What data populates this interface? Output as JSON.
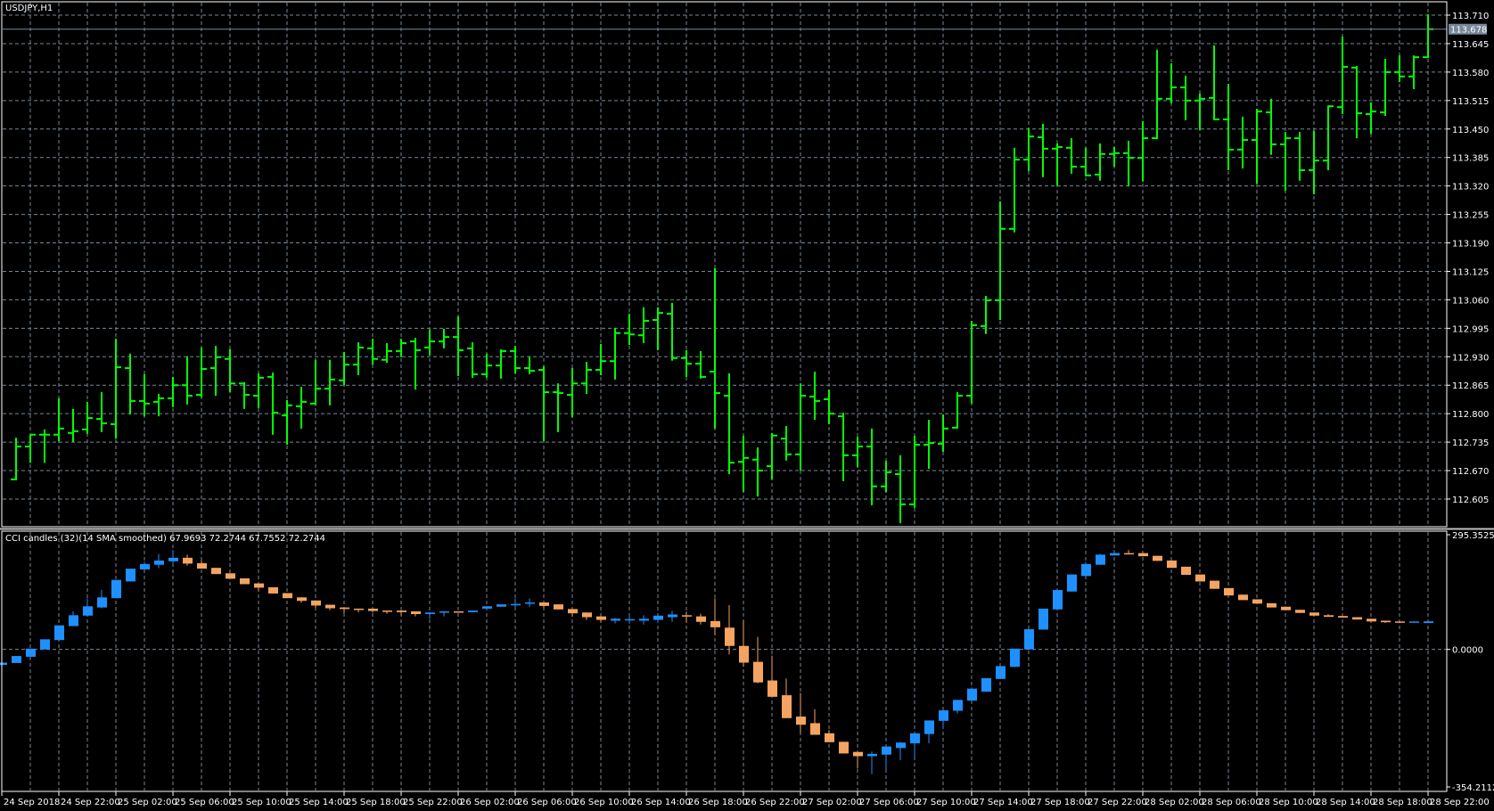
{
  "window": {
    "symbol_title": "USDJPY,H1"
  },
  "colors": {
    "background": "#000000",
    "grid": "#778899",
    "bars": "#00ff00",
    "cci_up": "#1e90ff",
    "cci_down": "#f4a460",
    "axis": "#ffffff",
    "current_price_bg": "#778899"
  },
  "chart_data": [
    {
      "type": "ohlc",
      "title": "USDJPY,H1",
      "ylim": [
        112.605,
        113.71
      ],
      "price_ticks": [
        "113.710",
        "113.645",
        "113.580",
        "113.515",
        "113.450",
        "113.385",
        "113.320",
        "113.255",
        "113.190",
        "113.125",
        "113.060",
        "112.995",
        "112.930",
        "112.865",
        "112.800",
        "112.735",
        "112.670",
        "112.605"
      ],
      "current_price": "113.678",
      "grid": true,
      "first_bar": 1,
      "bars_ohlc": [
        [
          112.65,
          112.745,
          112.65,
          112.725
        ],
        [
          112.725,
          112.752,
          112.69,
          112.752
        ],
        [
          112.752,
          112.764,
          112.69,
          112.752
        ],
        [
          112.752,
          112.835,
          112.739,
          112.766
        ],
        [
          112.756,
          112.811,
          112.737,
          112.76
        ],
        [
          112.764,
          112.827,
          112.756,
          112.79
        ],
        [
          112.788,
          112.849,
          112.76,
          112.778
        ],
        [
          112.776,
          112.971,
          112.745,
          112.906
        ],
        [
          112.904,
          112.937,
          112.8,
          112.829
        ],
        [
          112.829,
          112.89,
          112.796,
          112.823
        ],
        [
          112.827,
          112.845,
          112.796,
          112.835
        ],
        [
          112.835,
          112.884,
          112.817,
          112.865
        ],
        [
          112.865,
          112.931,
          112.823,
          112.841
        ],
        [
          112.843,
          112.951,
          112.839,
          112.902
        ],
        [
          112.904,
          112.955,
          112.843,
          112.929
        ],
        [
          112.925,
          112.947,
          112.851,
          112.869
        ],
        [
          112.869,
          112.872,
          112.813,
          112.843
        ],
        [
          112.841,
          112.892,
          112.815,
          112.882
        ],
        [
          112.884,
          112.894,
          112.754,
          112.802
        ],
        [
          112.796,
          112.831,
          112.731,
          112.819
        ],
        [
          112.817,
          112.861,
          112.768,
          112.827
        ],
        [
          112.823,
          112.923,
          112.821,
          112.857
        ],
        [
          112.857,
          112.923,
          112.821,
          112.878
        ],
        [
          112.876,
          112.941,
          112.867,
          112.912
        ],
        [
          112.912,
          112.963,
          112.89,
          112.951
        ],
        [
          112.949,
          112.971,
          112.914,
          112.925
        ],
        [
          112.923,
          112.961,
          112.918,
          112.943
        ],
        [
          112.943,
          112.971,
          112.931,
          112.961
        ],
        [
          112.965,
          112.973,
          112.857,
          112.945
        ],
        [
          112.951,
          112.992,
          112.935,
          112.965
        ],
        [
          112.965,
          112.994,
          112.951,
          112.975
        ],
        [
          112.975,
          113.022,
          112.888,
          112.945
        ],
        [
          112.949,
          112.963,
          112.884,
          112.89
        ],
        [
          112.89,
          112.937,
          112.884,
          112.91
        ],
        [
          112.91,
          112.947,
          112.882,
          112.943
        ],
        [
          112.943,
          112.955,
          112.894,
          112.904
        ],
        [
          112.904,
          112.931,
          112.892,
          112.898
        ],
        [
          112.9,
          112.908,
          112.739,
          112.849
        ],
        [
          112.849,
          112.869,
          112.76,
          112.847
        ],
        [
          112.843,
          112.904,
          112.794,
          112.869
        ],
        [
          112.869,
          112.918,
          112.847,
          112.9
        ],
        [
          112.9,
          112.959,
          112.89,
          112.92
        ],
        [
          112.92,
          112.996,
          112.88,
          112.984
        ],
        [
          112.984,
          113.028,
          112.959,
          112.981
        ],
        [
          112.979,
          113.043,
          112.963,
          113.012
        ],
        [
          113.014,
          113.043,
          112.947,
          113.03
        ],
        [
          113.028,
          113.053,
          112.923,
          112.927
        ],
        [
          112.927,
          112.945,
          112.886,
          112.914
        ],
        [
          112.914,
          112.943,
          112.882,
          112.884
        ],
        [
          112.896,
          113.132,
          112.768,
          112.847
        ],
        [
          112.841,
          112.892,
          112.664,
          112.688
        ],
        [
          112.69,
          112.75,
          112.623,
          112.699
        ],
        [
          112.695,
          112.723,
          112.613,
          112.67
        ],
        [
          112.68,
          112.756,
          112.652,
          112.75
        ],
        [
          112.743,
          112.772,
          112.695,
          112.707
        ],
        [
          112.707,
          112.869,
          112.672,
          112.841
        ],
        [
          112.839,
          112.896,
          112.788,
          112.829
        ],
        [
          112.833,
          112.855,
          112.778,
          112.8
        ],
        [
          112.794,
          112.802,
          112.648,
          112.705
        ],
        [
          112.705,
          112.747,
          112.68,
          112.725
        ],
        [
          112.725,
          112.766,
          112.593,
          112.634
        ],
        [
          112.634,
          112.692,
          112.623,
          112.666
        ],
        [
          112.662,
          112.705,
          112.552,
          112.593
        ],
        [
          112.593,
          112.75,
          112.587,
          112.729
        ],
        [
          112.729,
          112.786,
          112.676,
          112.733
        ],
        [
          112.731,
          112.798,
          112.715,
          112.766
        ],
        [
          112.768,
          112.849,
          112.768,
          112.841
        ],
        [
          112.841,
          113.012,
          112.825,
          113.002
        ],
        [
          113.0,
          113.069,
          112.984,
          113.059
        ],
        [
          113.059,
          113.285,
          113.016,
          113.222
        ],
        [
          113.222,
          113.407,
          113.216,
          113.38
        ],
        [
          113.38,
          113.452,
          113.356,
          113.433
        ],
        [
          113.431,
          113.462,
          113.342,
          113.405
        ],
        [
          113.405,
          113.417,
          113.323,
          113.409
        ],
        [
          113.407,
          113.429,
          113.35,
          113.364
        ],
        [
          113.364,
          113.407,
          113.344,
          113.344
        ],
        [
          113.346,
          113.417,
          113.334,
          113.393
        ],
        [
          113.393,
          113.409,
          113.366,
          113.395
        ],
        [
          113.395,
          113.423,
          113.321,
          113.384
        ],
        [
          113.384,
          113.468,
          113.332,
          113.429
        ],
        [
          113.429,
          113.631,
          113.429,
          113.519
        ],
        [
          113.519,
          113.6,
          113.511,
          113.545
        ],
        [
          113.545,
          113.572,
          113.472,
          113.515
        ],
        [
          113.515,
          113.531,
          113.45,
          113.519
        ],
        [
          113.521,
          113.641,
          113.472,
          113.472
        ],
        [
          113.472,
          113.553,
          113.358,
          113.403
        ],
        [
          113.403,
          113.478,
          113.362,
          113.425
        ],
        [
          113.425,
          113.496,
          113.327,
          113.49
        ],
        [
          113.488,
          113.519,
          113.393,
          113.415
        ],
        [
          113.415,
          113.443,
          113.311,
          113.429
        ],
        [
          113.429,
          113.443,
          113.334,
          113.356
        ],
        [
          113.356,
          113.446,
          113.303,
          113.378
        ],
        [
          113.378,
          113.504,
          113.358,
          113.502
        ],
        [
          113.5,
          113.661,
          113.486,
          113.592
        ],
        [
          113.59,
          113.594,
          113.431,
          113.486
        ],
        [
          113.484,
          113.511,
          113.441,
          113.49
        ],
        [
          113.488,
          113.61,
          113.482,
          113.58
        ],
        [
          113.58,
          113.618,
          113.559,
          113.57
        ],
        [
          113.57,
          113.618,
          113.543,
          113.614
        ],
        [
          113.614,
          113.712,
          113.614,
          113.678
        ]
      ]
    },
    {
      "type": "candlestick",
      "title": "CCI candles (32)(14 SMA smoothed) 67.9693 72.2744 67.7552 72.2744",
      "ylim": [
        -354.2112,
        295.3525
      ],
      "y_ticks": [
        "295.3525",
        "0.0000",
        "-354.2112"
      ],
      "first_bar": 0,
      "candles_ohlc": [
        [
          -40,
          -34,
          -40,
          -34
        ],
        [
          -35,
          -17,
          -35,
          -17
        ],
        [
          -19,
          2,
          -19,
          2
        ],
        [
          0,
          26,
          0,
          26
        ],
        [
          24,
          62,
          24,
          62
        ],
        [
          60,
          98,
          60,
          88
        ],
        [
          87,
          131,
          87,
          111
        ],
        [
          108,
          153,
          106,
          134
        ],
        [
          132,
          179,
          132,
          179
        ],
        [
          175,
          208,
          175,
          208
        ],
        [
          206,
          226,
          206,
          220
        ],
        [
          218,
          246,
          209,
          229
        ],
        [
          227,
          256,
          219,
          236
        ],
        [
          236,
          244,
          216,
          221
        ],
        [
          222,
          229,
          208,
          208
        ],
        [
          210,
          210,
          194,
          194
        ],
        [
          196,
          196,
          182,
          182
        ],
        [
          183,
          183,
          168,
          168
        ],
        [
          170,
          170,
          150,
          159
        ],
        [
          160,
          160,
          144,
          144
        ],
        [
          145,
          145,
          132,
          132
        ],
        [
          134,
          134,
          120,
          125
        ],
        [
          126,
          126,
          107,
          113
        ],
        [
          115,
          115,
          101,
          106
        ],
        [
          108,
          108,
          93,
          104
        ],
        [
          105,
          105,
          96,
          104
        ],
        [
          105,
          105,
          95,
          99
        ],
        [
          100,
          100,
          92,
          99
        ],
        [
          100,
          100,
          87,
          96
        ],
        [
          98,
          98,
          85,
          91
        ],
        [
          91,
          95,
          79,
          95
        ],
        [
          95,
          98,
          85,
          98
        ],
        [
          98,
          98,
          96,
          96
        ],
        [
          96,
          100,
          96,
          100
        ],
        [
          105,
          111,
          105,
          111
        ],
        [
          110,
          116,
          110,
          116
        ],
        [
          116,
          131,
          109,
          117
        ],
        [
          119,
          131,
          109,
          121
        ],
        [
          121,
          121,
          107,
          112
        ],
        [
          116,
          116,
          103,
          103
        ],
        [
          104,
          104,
          84,
          93
        ],
        [
          95,
          95,
          76,
          83
        ],
        [
          85,
          85,
          70,
          76
        ],
        [
          74,
          81,
          67,
          79
        ],
        [
          77,
          87,
          66,
          78
        ],
        [
          74,
          88,
          64,
          79
        ],
        [
          76,
          87,
          69,
          87
        ],
        [
          83,
          99,
          71,
          90
        ],
        [
          88,
          97,
          68,
          86
        ],
        [
          85,
          92,
          64,
          71
        ],
        [
          73,
          131,
          37,
          57
        ],
        [
          56,
          114,
          -13,
          9
        ],
        [
          9,
          74,
          -45,
          -34
        ],
        [
          -32,
          32,
          -87,
          -85
        ],
        [
          -80,
          -16,
          -122,
          -122
        ],
        [
          -118,
          -75,
          -177,
          -177
        ],
        [
          -173,
          -112,
          -216,
          -194
        ],
        [
          -190,
          -154,
          -220,
          -220
        ],
        [
          -216,
          -208,
          -239,
          -239
        ],
        [
          -238,
          -238,
          -268,
          -268
        ],
        [
          -264,
          -264,
          -307,
          -275
        ],
        [
          -275,
          -263,
          -321,
          -269
        ],
        [
          -271,
          -250,
          -309,
          -250
        ],
        [
          -254,
          -238,
          -285,
          -240
        ],
        [
          -242,
          -216,
          -280,
          -216
        ],
        [
          -218,
          -183,
          -242,
          -183
        ],
        [
          -184,
          -157,
          -203,
          -157
        ],
        [
          -158,
          -130,
          -165,
          -130
        ],
        [
          -132,
          -98,
          -132,
          -101
        ],
        [
          -109,
          -74,
          -109,
          -74
        ],
        [
          -76,
          -43,
          -76,
          -43
        ],
        [
          -45,
          2,
          -45,
          2
        ],
        [
          0,
          52,
          0,
          52
        ],
        [
          51,
          105,
          51,
          105
        ],
        [
          103,
          153,
          103,
          153
        ],
        [
          149,
          193,
          149,
          193
        ],
        [
          189,
          225,
          189,
          220
        ],
        [
          218,
          246,
          218,
          244
        ],
        [
          242,
          256,
          242,
          248
        ],
        [
          248,
          256,
          247,
          247
        ],
        [
          248,
          248,
          240,
          240
        ],
        [
          241,
          241,
          228,
          228
        ],
        [
          229,
          229,
          210,
          210
        ],
        [
          213,
          213,
          192,
          192
        ],
        [
          193,
          193,
          175,
          175
        ],
        [
          177,
          177,
          156,
          156
        ],
        [
          158,
          158,
          139,
          139
        ],
        [
          141,
          141,
          127,
          127
        ],
        [
          129,
          129,
          118,
          118
        ],
        [
          119,
          119,
          108,
          108
        ],
        [
          110,
          110,
          101,
          101
        ],
        [
          102,
          102,
          94,
          94
        ],
        [
          95,
          95,
          87,
          87
        ],
        [
          88,
          91,
          84,
          84
        ],
        [
          86,
          86,
          82,
          82
        ],
        [
          83,
          83,
          77,
          77
        ],
        [
          79,
          79,
          72,
          72
        ],
        [
          74,
          74,
          68,
          70
        ],
        [
          72,
          72,
          70,
          70
        ],
        [
          70,
          72,
          70,
          72
        ],
        [
          67.9693,
          72.2744,
          67.7552,
          72.2744
        ]
      ]
    }
  ],
  "time_labels": [
    "24 Sep 2018",
    "24 Sep 22:00",
    "25 Sep 02:00",
    "25 Sep 06:00",
    "25 Sep 10:00",
    "25 Sep 14:00",
    "25 Sep 18:00",
    "25 Sep 22:00",
    "26 Sep 02:00",
    "26 Sep 06:00",
    "26 Sep 10:00",
    "26 Sep 14:00",
    "26 Sep 18:00",
    "26 Sep 22:00",
    "27 Sep 02:00",
    "27 Sep 06:00",
    "27 Sep 10:00",
    "27 Sep 14:00",
    "27 Sep 18:00",
    "27 Sep 22:00",
    "28 Sep 02:00",
    "28 Sep 06:00",
    "28 Sep 10:00",
    "28 Sep 14:00",
    "28 Sep 18:00",
    "28 Sep 22:00"
  ]
}
